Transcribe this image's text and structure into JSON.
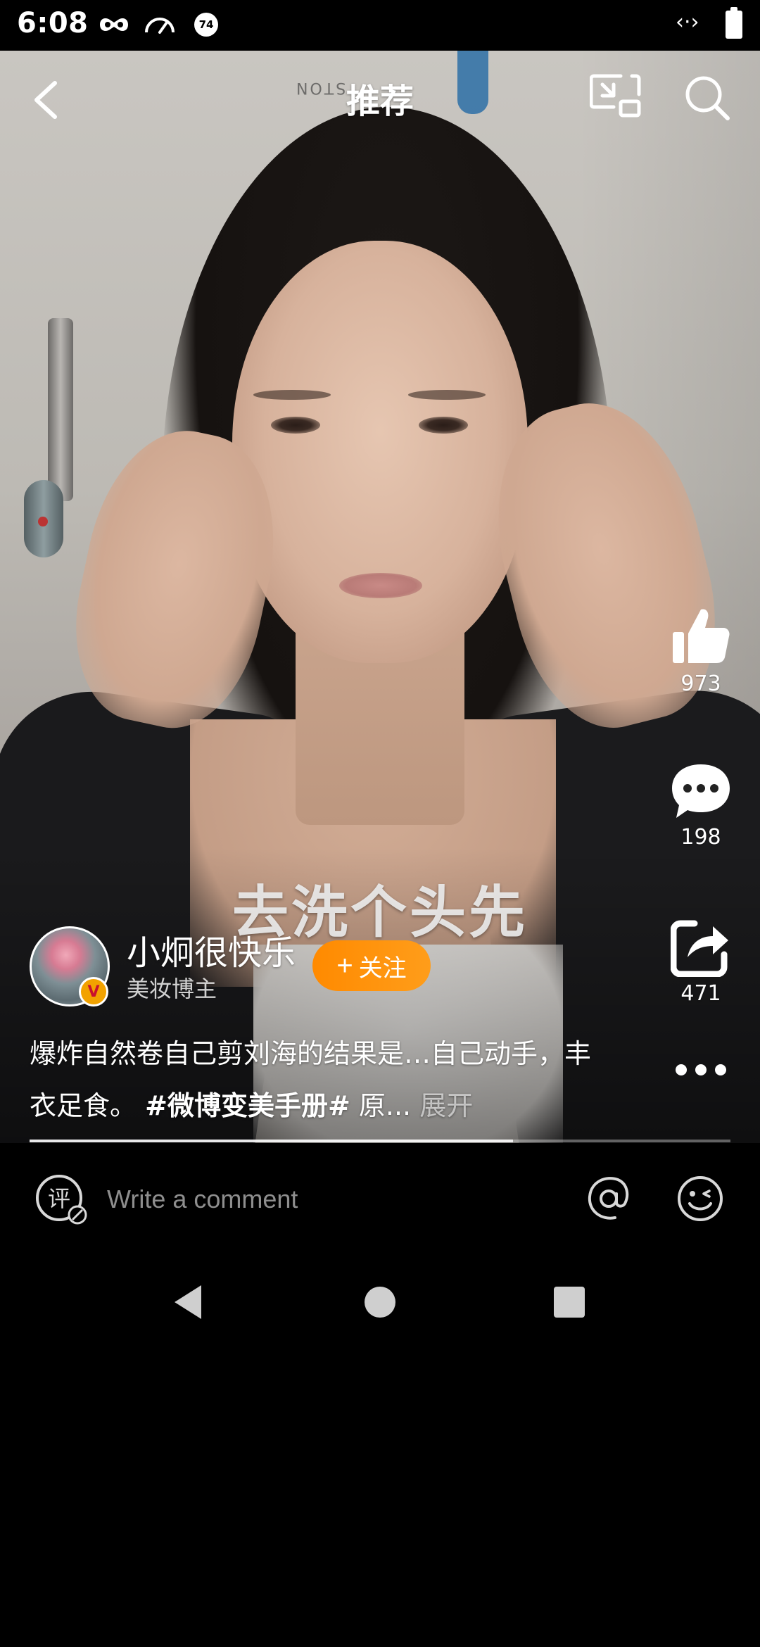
{
  "status_bar": {
    "time": "6:08",
    "badge": "74",
    "code_glyph": "‹·›"
  },
  "nav": {
    "title": "推荐"
  },
  "video": {
    "caption": "去洗个头先",
    "background_text": "STON"
  },
  "actions": {
    "like_count": "973",
    "comment_count": "198",
    "share_count": "471"
  },
  "author": {
    "name": "小炯很快乐",
    "tag": "美妆博主",
    "verified_mark": "V",
    "follow_plus": "+",
    "follow_label": "关注"
  },
  "description": {
    "text": "爆炸自然卷自己剪刘海的结果是…自己动手，丰衣足食。",
    "hashtag": "#微博变美手册#",
    "truncated": "原...",
    "expand_label": "展开"
  },
  "progress": {
    "played_fraction": 0.69
  },
  "comment_bar": {
    "placeholder": "Write a comment",
    "comment_icon_text": "评"
  },
  "icons": {
    "back": "chevron-left-icon",
    "screen": "picture-in-picture-icon",
    "search": "search-icon",
    "like": "thumbs-up-icon",
    "comment": "speech-bubble-icon",
    "share": "share-icon",
    "more": "more-dots-icon",
    "at": "at-sign-icon",
    "emoji": "emoji-icon"
  },
  "colors": {
    "follow_button": "#ff8a00",
    "verified_badge": "#f2a200"
  }
}
